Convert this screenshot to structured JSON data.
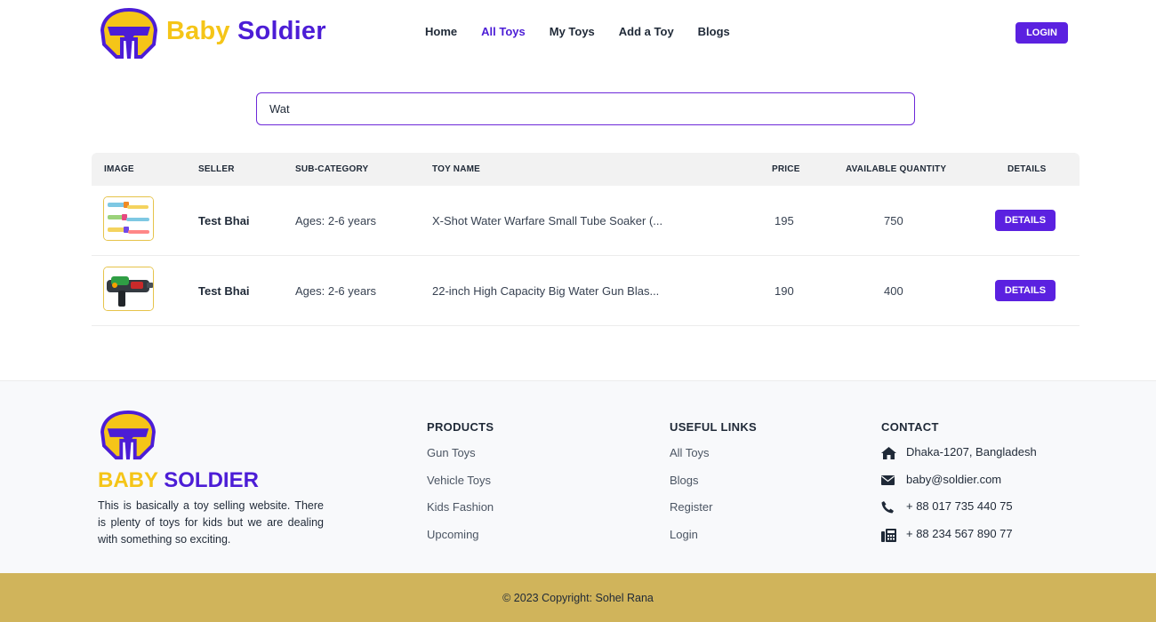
{
  "header": {
    "brand_part1": "Baby",
    "brand_part2": "Soldier",
    "nav": [
      {
        "label": "Home",
        "active": false
      },
      {
        "label": "All Toys",
        "active": true
      },
      {
        "label": "My Toys",
        "active": false
      },
      {
        "label": "Add a Toy",
        "active": false
      },
      {
        "label": "Blogs",
        "active": false
      }
    ],
    "login_label": "LOGIN"
  },
  "search": {
    "value": "Wat"
  },
  "table": {
    "headers": {
      "image": "IMAGE",
      "seller": "SELLER",
      "subcategory": "SUB-CATEGORY",
      "toy_name": "TOY NAME",
      "price": "PRICE",
      "quantity": "AVAILABLE QUANTITY",
      "details": "DETAILS"
    },
    "rows": [
      {
        "seller": "Test Bhai",
        "subcategory": "Ages: 2-6 years",
        "toy_name": "X-Shot Water Warfare Small Tube Soaker (...",
        "price": "195",
        "quantity": "750",
        "details_label": "DETAILS"
      },
      {
        "seller": "Test Bhai",
        "subcategory": "Ages: 2-6 years",
        "toy_name": "22-inch High Capacity Big Water Gun Blas...",
        "price": "190",
        "quantity": "400",
        "details_label": "DETAILS"
      }
    ]
  },
  "footer": {
    "brand_part1": "BABY",
    "brand_part2": "SOLDIER",
    "description": "This is basically a toy selling website. There is plenty of toys for kids but we are dealing with something so exciting.",
    "products": {
      "title": "PRODUCTS",
      "items": [
        "Gun Toys",
        "Vehicle Toys",
        "Kids Fashion",
        "Upcoming"
      ]
    },
    "useful_links": {
      "title": "USEFUL LINKS",
      "items": [
        "All Toys",
        "Blogs",
        "Register",
        "Login"
      ]
    },
    "contact": {
      "title": "CONTACT",
      "items": [
        {
          "icon": "home-icon",
          "text": "Dhaka-1207, Bangladesh"
        },
        {
          "icon": "envelope-icon",
          "text": "baby@soldier.com"
        },
        {
          "icon": "phone-icon",
          "text": "+ 88 017 735 440 75"
        },
        {
          "icon": "fax-icon",
          "text": "+ 88 234 567 890 77"
        }
      ]
    },
    "copyright": "© 2023 Copyright: Sohel Rana"
  },
  "colors": {
    "brand_yellow": "#f5c518",
    "brand_purple": "#4c1dd6",
    "button_purple": "#5b21e0",
    "footer_bar": "#d0b45b"
  }
}
